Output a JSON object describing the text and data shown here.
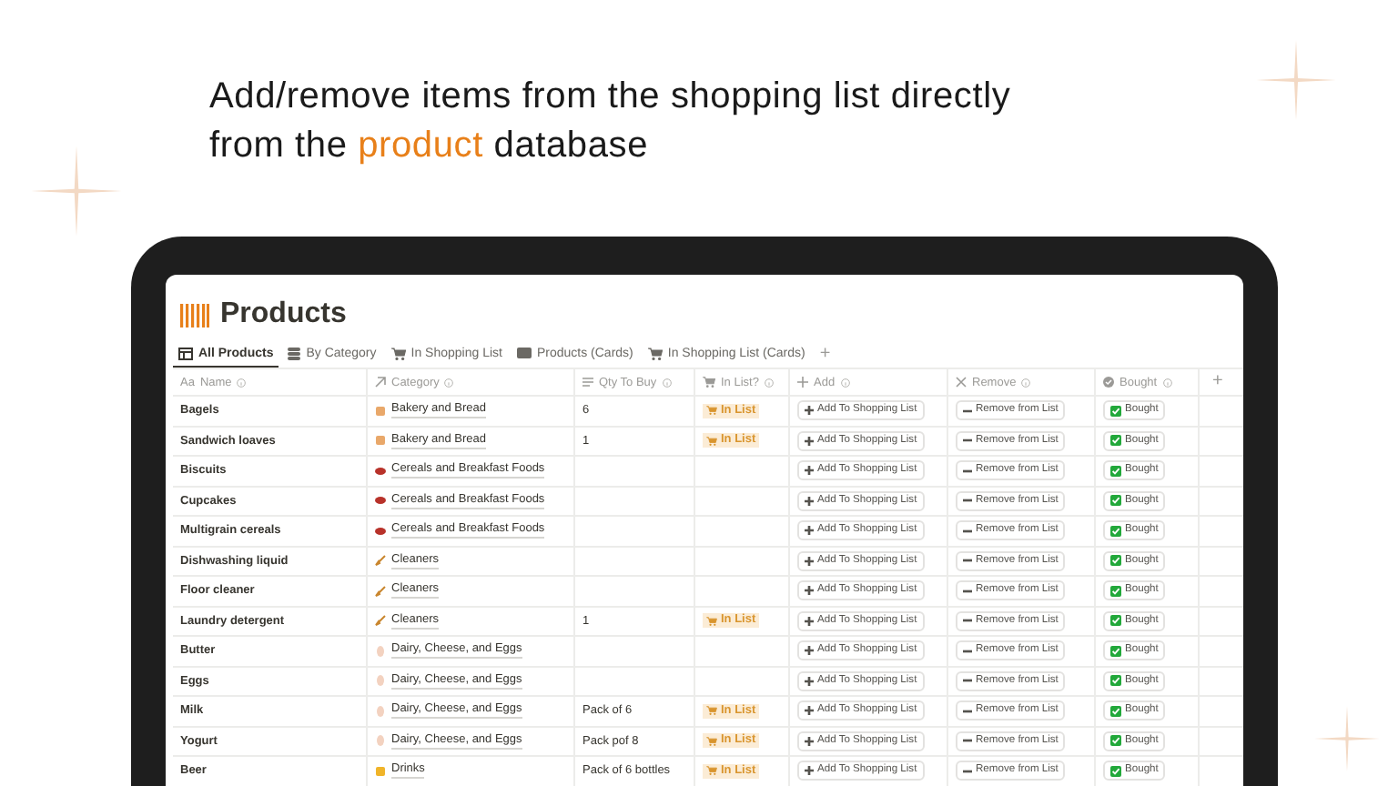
{
  "headline": {
    "text": "Add/remove items from the shopping list directly from the **product** database"
  },
  "page": {
    "title": "Products"
  },
  "tabs": [
    {
      "label": "All Products",
      "kind": "table",
      "selected": true
    },
    {
      "label": "By Category",
      "kind": "stack",
      "selected": false
    },
    {
      "label": "In Shopping List",
      "kind": "cart",
      "selected": false
    },
    {
      "label": "Products (Cards)",
      "kind": "card",
      "selected": false
    },
    {
      "label": "In Shopping List (Cards)",
      "kind": "cart",
      "selected": false
    }
  ],
  "add_view": "+",
  "columns": [
    {
      "label": "Name",
      "kind": "title",
      "type_mark": "Aa"
    },
    {
      "label": "Category",
      "kind": "relation"
    },
    {
      "label": "Qty To Buy",
      "kind": "text"
    },
    {
      "label": "In List?",
      "kind": "cart"
    },
    {
      "label": "Add",
      "kind": "plus"
    },
    {
      "label": "Remove",
      "kind": "cross"
    },
    {
      "label": "Bought",
      "kind": "check"
    }
  ],
  "add_column": "+",
  "rows": [
    {
      "name": "Bagels",
      "category": {
        "label": "Bakery and Bread",
        "kind": "bread"
      },
      "qty": "6",
      "in_list": "In List",
      "add": "Add To Shopping List",
      "remove": "Remove from List",
      "bought": "Bought"
    },
    {
      "name": "Sandwich loaves",
      "category": {
        "label": "Bakery and Bread",
        "kind": "bread"
      },
      "qty": "1",
      "in_list": "In List",
      "add": "Add To Shopping List",
      "remove": "Remove from List",
      "bought": "Bought"
    },
    {
      "name": "Biscuits",
      "category": {
        "label": "Cereals and Breakfast Foods",
        "kind": "bowl"
      },
      "add": "Add To Shopping List",
      "remove": "Remove from List",
      "bought": "Bought"
    },
    {
      "name": "Cupcakes",
      "category": {
        "label": "Cereals and Breakfast Foods",
        "kind": "bowl"
      },
      "add": "Add To Shopping List",
      "remove": "Remove from List",
      "bought": "Bought"
    },
    {
      "name": "Multigrain cereals",
      "category": {
        "label": "Cereals and Breakfast Foods",
        "kind": "bowl"
      },
      "add": "Add To Shopping List",
      "remove": "Remove from List",
      "bought": "Bought"
    },
    {
      "name": "Dishwashing liquid",
      "category": {
        "label": "Cleaners",
        "kind": "broom"
      },
      "add": "Add To Shopping List",
      "remove": "Remove from List",
      "bought": "Bought"
    },
    {
      "name": "Floor cleaner",
      "category": {
        "label": "Cleaners",
        "kind": "broom"
      },
      "add": "Add To Shopping List",
      "remove": "Remove from List",
      "bought": "Bought"
    },
    {
      "name": "Laundry detergent",
      "category": {
        "label": "Cleaners",
        "kind": "broom"
      },
      "qty": "1",
      "in_list": "In List",
      "add": "Add To Shopping List",
      "remove": "Remove from List",
      "bought": "Bought"
    },
    {
      "name": "Butter",
      "category": {
        "label": "Dairy, Cheese, and Eggs",
        "kind": "egg"
      },
      "add": "Add To Shopping List",
      "remove": "Remove from List",
      "bought": "Bought"
    },
    {
      "name": "Eggs",
      "category": {
        "label": "Dairy, Cheese, and Eggs",
        "kind": "egg"
      },
      "add": "Add To Shopping List",
      "remove": "Remove from List",
      "bought": "Bought"
    },
    {
      "name": "Milk",
      "category": {
        "label": "Dairy, Cheese, and Eggs",
        "kind": "egg"
      },
      "qty": "Pack of 6",
      "in_list": "In List",
      "add": "Add To Shopping List",
      "remove": "Remove from List",
      "bought": "Bought"
    },
    {
      "name": "Yogurt",
      "category": {
        "label": "Dairy, Cheese, and Eggs",
        "kind": "egg"
      },
      "qty": "Pack pof 8",
      "in_list": "In List",
      "add": "Add To Shopping List",
      "remove": "Remove from List",
      "bought": "Bought"
    },
    {
      "name": "Beer",
      "category": {
        "label": "Drinks",
        "kind": "cup"
      },
      "qty": "Pack of 6 bottles",
      "in_list": "In List",
      "add": "Add To Shopping List",
      "remove": "Remove from List",
      "bought": "Bought"
    }
  ]
}
